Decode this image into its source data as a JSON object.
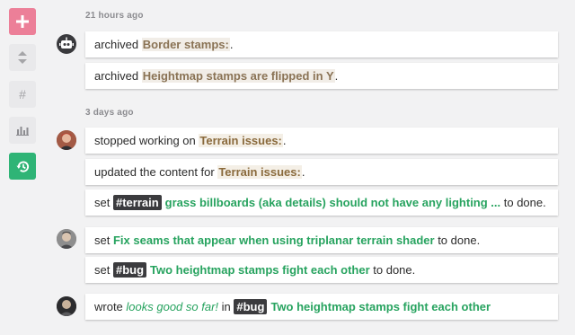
{
  "sidebar": {
    "add": "+",
    "hash": "#"
  },
  "groups": [
    {
      "time": "21 hours ago",
      "avatar": "robot-avatar",
      "cards": [
        {
          "parts": [
            {
              "text": "archived "
            },
            {
              "text": "Border stamps:",
              "style": "brown"
            },
            {
              "text": "."
            }
          ]
        },
        {
          "parts": [
            {
              "text": "archived "
            },
            {
              "text": "Heightmap stamps are flipped in Y",
              "style": "brown"
            },
            {
              "text": "."
            }
          ]
        }
      ]
    },
    {
      "time": "3 days ago",
      "avatar": "user-avatar-red",
      "cards": [
        {
          "parts": [
            {
              "text": "stopped working on "
            },
            {
              "text": "Terrain issues:",
              "style": "orange"
            },
            {
              "text": "."
            }
          ]
        },
        {
          "parts": [
            {
              "text": "updated the content for "
            },
            {
              "text": "Terrain issues:",
              "style": "orange"
            },
            {
              "text": "."
            }
          ]
        },
        {
          "parts": [
            {
              "text": "set "
            },
            {
              "text": "#terrain",
              "style": "tag"
            },
            {
              "text": "grass billboards (aka details) should not have any lighting ...",
              "style": "green"
            },
            {
              "text": " to done."
            }
          ]
        }
      ]
    },
    {
      "time": "",
      "avatar": "user-avatar-gray",
      "cards": [
        {
          "parts": [
            {
              "text": "set "
            },
            {
              "text": "Fix seams that appear when using triplanar terrain shader",
              "style": "green"
            },
            {
              "text": " to done."
            }
          ]
        },
        {
          "parts": [
            {
              "text": "set "
            },
            {
              "text": "#bug",
              "style": "tag"
            },
            {
              "text": "Two heightmap stamps fight each other",
              "style": "green"
            },
            {
              "text": " to done."
            }
          ]
        }
      ]
    },
    {
      "time": "",
      "avatar": "user-avatar-dark",
      "cards": [
        {
          "parts": [
            {
              "text": "wrote "
            },
            {
              "text": "looks good so far!",
              "style": "green-it"
            },
            {
              "text": " in "
            },
            {
              "text": "#bug",
              "style": "tag"
            },
            {
              "text": "Two heightmap stamps fight each other",
              "style": "green"
            }
          ]
        }
      ]
    }
  ]
}
